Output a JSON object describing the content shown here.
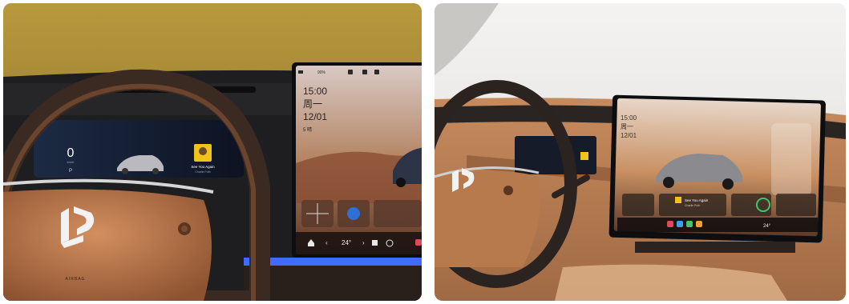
{
  "left_photo": {
    "center_screen": {
      "status_bar": "90%",
      "time": "15:00",
      "weekday": "周一",
      "date": "12/01",
      "weather": "5 晴",
      "temperature": "24°"
    },
    "cluster": {
      "speed": "0",
      "speed_unit": "km/h",
      "gear": "P",
      "media_title": "See You Again",
      "media_artist": "Charlie Puth"
    },
    "steering_wheel": {
      "airbag_text": "AIRBAG"
    }
  },
  "right_photo": {
    "center_screen": {
      "time": "15:00",
      "weekday": "周一",
      "date": "12/01",
      "temperature": "24°",
      "media_title": "See You Again",
      "media_artist": "Charlie Puth"
    }
  },
  "colors": {
    "leather": "#b9774a",
    "wheel_rim": "#3a2a22",
    "dash_dark": "#1b1b1d",
    "wall_left": "#a58a35",
    "ambient_blue": "#3f6bff"
  }
}
